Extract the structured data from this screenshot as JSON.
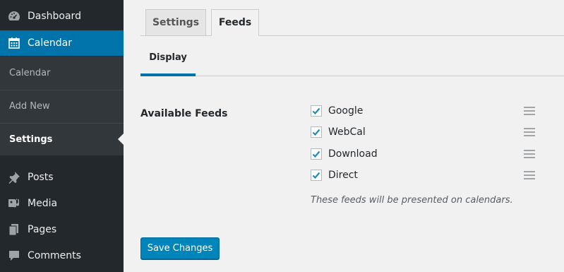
{
  "sidebar": {
    "items": [
      {
        "label": "Dashboard",
        "icon": "dashboard-icon"
      },
      {
        "label": "Calendar",
        "icon": "calendar-icon",
        "active": true
      },
      {
        "label": "Posts",
        "icon": "pin-icon"
      },
      {
        "label": "Media",
        "icon": "media-icon"
      },
      {
        "label": "Pages",
        "icon": "pages-icon"
      },
      {
        "label": "Comments",
        "icon": "comment-icon"
      }
    ],
    "submenu": [
      {
        "label": "Calendar"
      },
      {
        "label": "Add New"
      },
      {
        "label": "Settings",
        "current": true
      }
    ]
  },
  "tabs": [
    {
      "label": "Settings",
      "active": false
    },
    {
      "label": "Feeds",
      "active": true
    }
  ],
  "subtabs": [
    {
      "label": "Display",
      "active": true
    }
  ],
  "form": {
    "field_label": "Available Feeds",
    "feeds": [
      {
        "label": "Google",
        "checked": true
      },
      {
        "label": "WebCal",
        "checked": true
      },
      {
        "label": "Download",
        "checked": true
      },
      {
        "label": "Direct",
        "checked": true
      }
    ],
    "description": "These feeds will be presented on calendars."
  },
  "save_button": "Save Changes",
  "colors": {
    "sidebar_bg": "#23282d",
    "submenu_bg": "#32373c",
    "accent": "#0073aa",
    "button": "#0085ba",
    "checkmark": "#1e8cbe"
  }
}
